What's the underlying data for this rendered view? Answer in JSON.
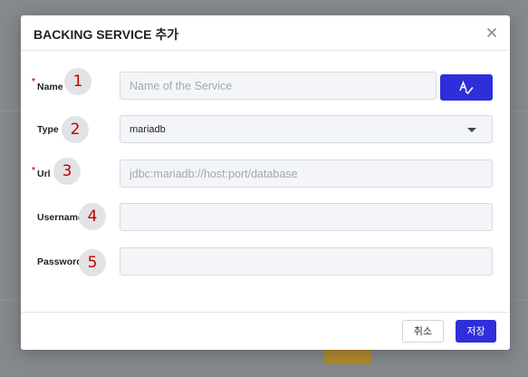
{
  "dialog": {
    "title": "BACKING SERVICE 추가",
    "close_icon": "close-icon"
  },
  "fields": [
    {
      "label": "Name",
      "required": true,
      "badge": "1",
      "placeholder": "Name of the Service",
      "value": ""
    },
    {
      "label": "Type",
      "required": false,
      "badge": "2",
      "value": "mariadb"
    },
    {
      "label": "Url",
      "required": true,
      "badge": "3",
      "placeholder": "jdbc:mariadb://host:port/database",
      "value": ""
    },
    {
      "label": "Username",
      "required": false,
      "badge": "4",
      "value": ""
    },
    {
      "label": "Password",
      "required": false,
      "badge": "5",
      "value": ""
    }
  ],
  "required_marker": "*",
  "generate_button_icon": "spellcheck-icon",
  "footer": {
    "cancel_label": "취소",
    "save_label": "저장"
  },
  "colors": {
    "primary": "#2f2fd9",
    "required": "#e02020",
    "badge_text": "#c00000",
    "input_bg": "#f3f5f8"
  }
}
